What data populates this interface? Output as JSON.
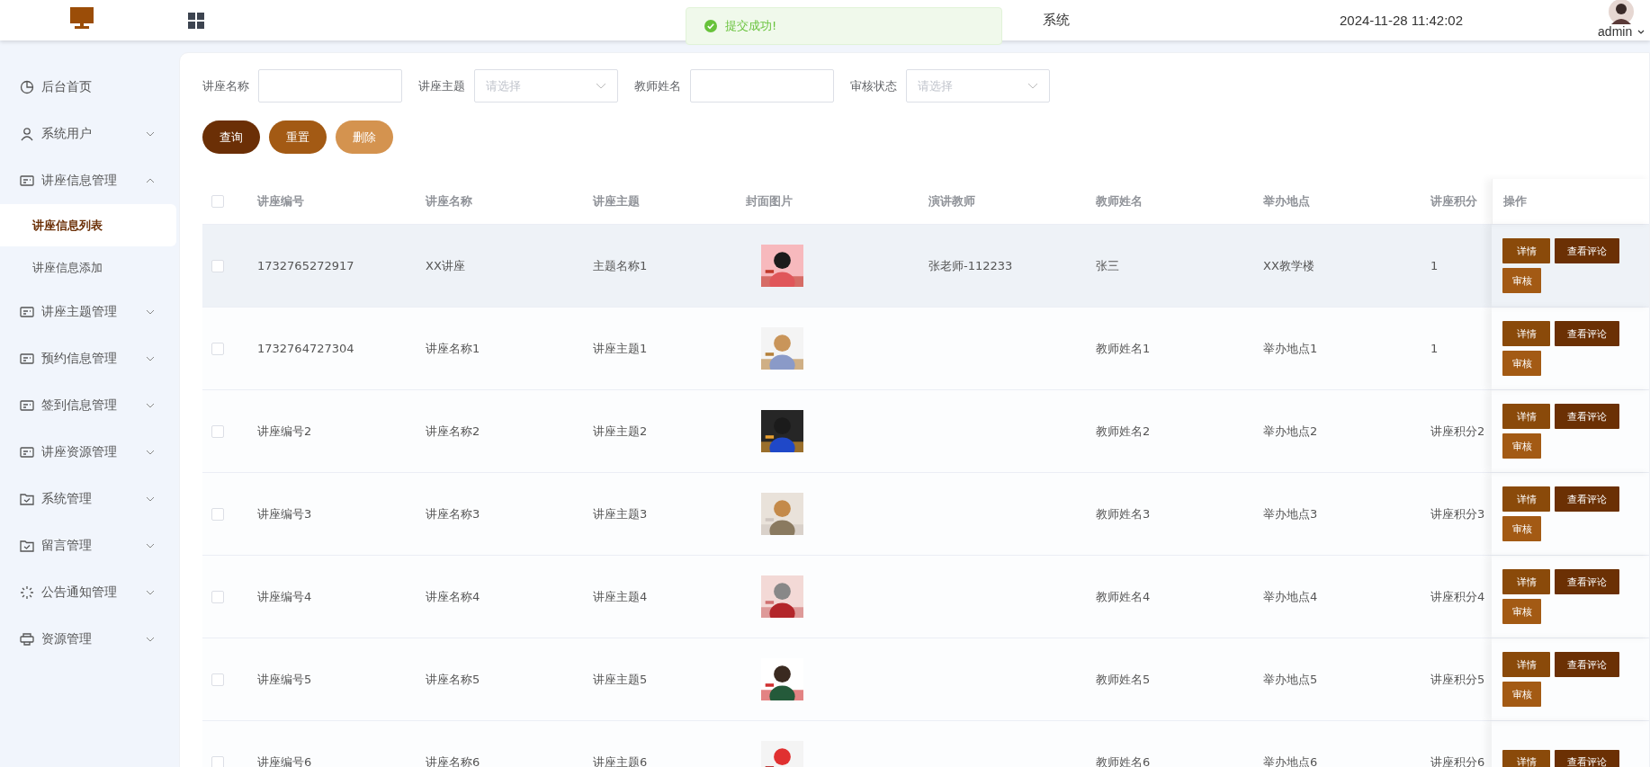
{
  "header": {
    "title": "系统",
    "datetime": "2024-11-28 11:42:02",
    "user": "admin"
  },
  "toast": {
    "message": "提交成功!"
  },
  "sidebar": {
    "items": [
      {
        "label": "后台首页",
        "kind": "link"
      },
      {
        "label": "系统用户",
        "kind": "group",
        "expanded": false
      },
      {
        "label": "讲座信息管理",
        "kind": "group",
        "expanded": true,
        "children": [
          {
            "label": "讲座信息列表",
            "selected": true
          },
          {
            "label": "讲座信息添加",
            "selected": false
          }
        ]
      },
      {
        "label": "讲座主题管理",
        "kind": "group",
        "expanded": false
      },
      {
        "label": "预约信息管理",
        "kind": "group",
        "expanded": false
      },
      {
        "label": "签到信息管理",
        "kind": "group",
        "expanded": false
      },
      {
        "label": "讲座资源管理",
        "kind": "group",
        "expanded": false
      },
      {
        "label": "系统管理",
        "kind": "group",
        "expanded": false
      },
      {
        "label": "留言管理",
        "kind": "group",
        "expanded": false
      },
      {
        "label": "公告通知管理",
        "kind": "group",
        "expanded": false
      },
      {
        "label": "资源管理",
        "kind": "group",
        "expanded": false
      }
    ]
  },
  "filters": [
    {
      "label": "讲座名称",
      "kind": "text"
    },
    {
      "label": "讲座主题",
      "kind": "select",
      "placeholder": "请选择"
    },
    {
      "label": "教师姓名",
      "kind": "text"
    },
    {
      "label": "审核状态",
      "kind": "select",
      "placeholder": "请选择"
    }
  ],
  "buttons": [
    {
      "label": "查询",
      "kind": "query"
    },
    {
      "label": "重置",
      "kind": "reset"
    },
    {
      "label": "删除",
      "kind": "delete"
    }
  ],
  "table": {
    "all_checked": false,
    "columns": [
      "讲座编号",
      "讲座名称",
      "讲座主题",
      "封面图片",
      "演讲教师",
      "教师姓名",
      "举办地点",
      "讲座积分",
      "操作"
    ],
    "rows": [
      {
        "checked": false,
        "highlighted": true,
        "id": "1732765272917",
        "name": "XX讲座",
        "topic": "主题名称1",
        "cover": {
          "kind": "picture"
        },
        "speaker": "张老师-112233",
        "teacher": "张三",
        "place": "XX教学楼",
        "points": "1",
        "actions": [
          {
            "label": "详情",
            "kind": "detail"
          },
          {
            "label": "查看评论",
            "kind": "comments"
          },
          {
            "label": "审核",
            "kind": "review"
          }
        ]
      },
      {
        "checked": false,
        "highlighted": false,
        "id": "1732764727304",
        "name": "讲座名称1",
        "topic": "讲座主题1",
        "cover": {
          "kind": "picture"
        },
        "teacher": "教师姓名1",
        "place": "举办地点1",
        "points": "1",
        "actions": [
          {
            "label": "详情",
            "kind": "detail"
          },
          {
            "label": "查看评论",
            "kind": "comments"
          },
          {
            "label": "审核",
            "kind": "review"
          }
        ]
      },
      {
        "checked": false,
        "highlighted": false,
        "id": "讲座编号2",
        "name": "讲座名称2",
        "topic": "讲座主题2",
        "cover": {
          "kind": "picture"
        },
        "teacher": "教师姓名2",
        "place": "举办地点2",
        "points": "讲座积分2",
        "actions": [
          {
            "label": "详情",
            "kind": "detail"
          },
          {
            "label": "查看评论",
            "kind": "comments"
          },
          {
            "label": "审核",
            "kind": "review"
          }
        ]
      },
      {
        "checked": false,
        "highlighted": false,
        "id": "讲座编号3",
        "name": "讲座名称3",
        "topic": "讲座主题3",
        "cover": {
          "kind": "picture"
        },
        "teacher": "教师姓名3",
        "place": "举办地点3",
        "points": "讲座积分3",
        "actions": [
          {
            "label": "详情",
            "kind": "detail"
          },
          {
            "label": "查看评论",
            "kind": "comments"
          },
          {
            "label": "审核",
            "kind": "review"
          }
        ]
      },
      {
        "checked": false,
        "highlighted": false,
        "id": "讲座编号4",
        "name": "讲座名称4",
        "topic": "讲座主题4",
        "cover": {
          "kind": "picture"
        },
        "teacher": "教师姓名4",
        "place": "举办地点4",
        "points": "讲座积分4",
        "actions": [
          {
            "label": "详情",
            "kind": "detail"
          },
          {
            "label": "查看评论",
            "kind": "comments"
          },
          {
            "label": "审核",
            "kind": "review"
          }
        ]
      },
      {
        "checked": false,
        "highlighted": false,
        "id": "讲座编号5",
        "name": "讲座名称5",
        "topic": "讲座主题5",
        "cover": {
          "kind": "picture"
        },
        "teacher": "教师姓名5",
        "place": "举办地点5",
        "points": "讲座积分5",
        "actions": [
          {
            "label": "详情",
            "kind": "detail"
          },
          {
            "label": "查看评论",
            "kind": "comments"
          },
          {
            "label": "审核",
            "kind": "review"
          }
        ]
      },
      {
        "checked": false,
        "highlighted": false,
        "id": "讲座编号6",
        "name": "讲座名称6",
        "topic": "讲座主题6",
        "cover": {
          "kind": "picture"
        },
        "teacher": "教师姓名6",
        "place": "举办地点6",
        "points": "讲座积分6",
        "actions": [
          {
            "label": "详情",
            "kind": "detail"
          },
          {
            "label": "查看评论",
            "kind": "comments"
          }
        ]
      }
    ]
  }
}
